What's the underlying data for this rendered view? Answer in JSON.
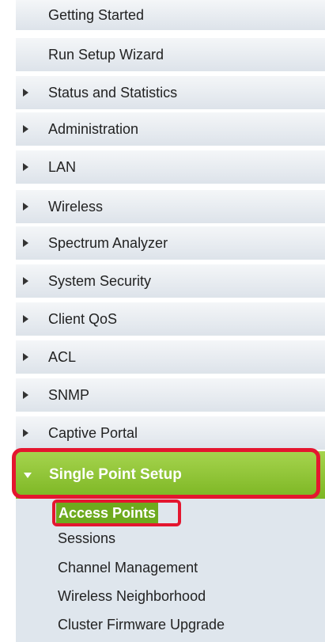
{
  "nav": {
    "items": [
      {
        "label": "Getting Started",
        "expandable": false
      },
      {
        "label": "Run Setup Wizard",
        "expandable": false
      },
      {
        "label": "Status and Statistics",
        "expandable": true
      },
      {
        "label": "Administration",
        "expandable": true
      },
      {
        "label": "LAN",
        "expandable": true
      },
      {
        "label": "Wireless",
        "expandable": true
      },
      {
        "label": "Spectrum Analyzer",
        "expandable": true
      },
      {
        "label": "System Security",
        "expandable": true
      },
      {
        "label": "Client QoS",
        "expandable": true
      },
      {
        "label": "ACL",
        "expandable": true
      },
      {
        "label": "SNMP",
        "expandable": true
      },
      {
        "label": "Captive Portal",
        "expandable": true
      }
    ],
    "active_group": {
      "label": "Single Point Setup",
      "expanded": true,
      "children": [
        {
          "label": "Access Points",
          "selected": true
        },
        {
          "label": "Sessions",
          "selected": false
        },
        {
          "label": "Channel Management",
          "selected": false
        },
        {
          "label": "Wireless Neighborhood",
          "selected": false
        },
        {
          "label": "Cluster Firmware Upgrade",
          "selected": false
        }
      ]
    }
  },
  "colors": {
    "item_bg": "#e6ebf0",
    "active_green": "#8cc63f",
    "highlight_red": "#e4162f",
    "text": "#222222"
  }
}
